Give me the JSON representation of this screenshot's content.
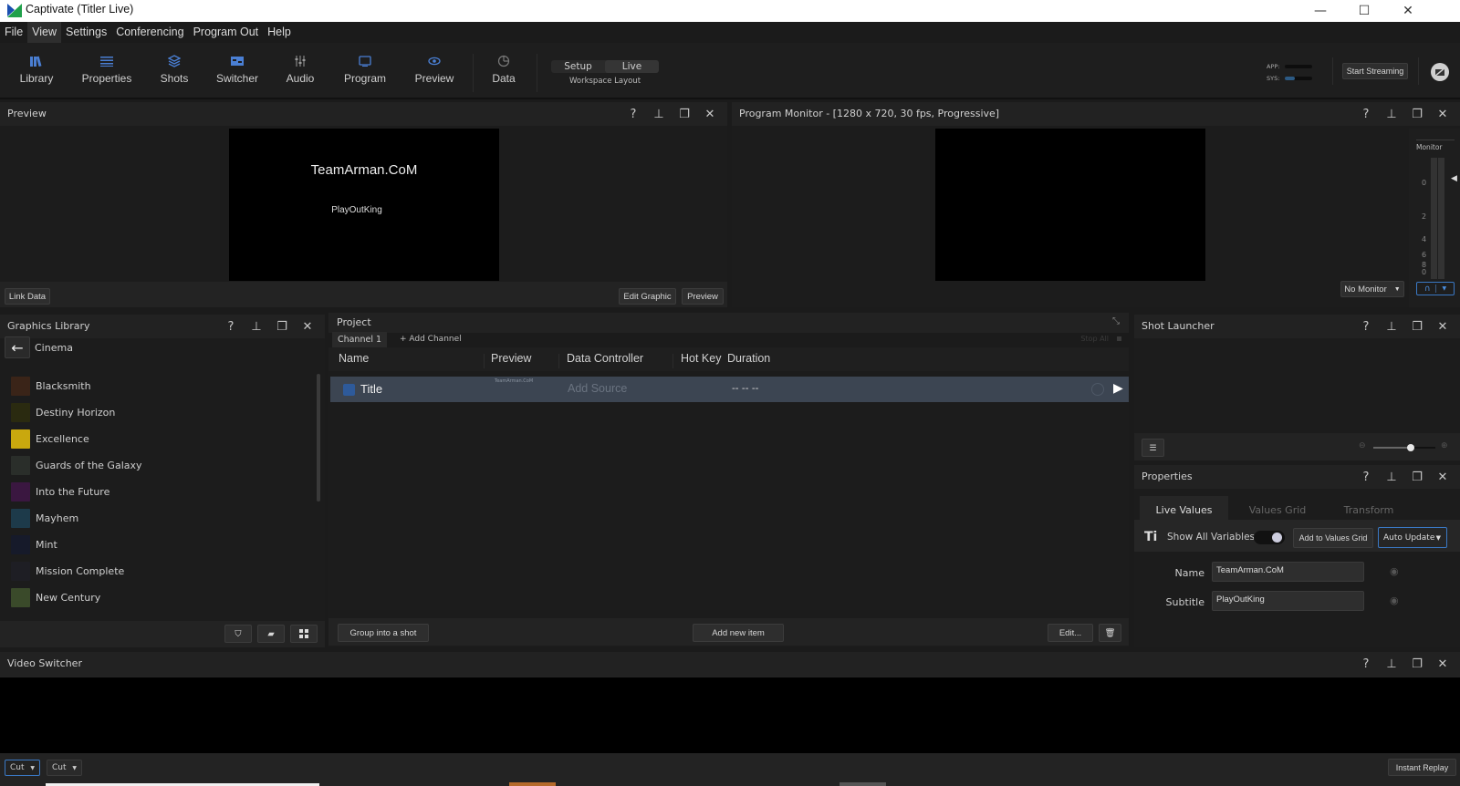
{
  "window": {
    "title": "Captivate (Titler Live)",
    "controls": {
      "minimize": "—",
      "maximize": "☐",
      "close": "✕"
    }
  },
  "menu": [
    "File",
    "View",
    "Settings",
    "Conferencing",
    "Program Out",
    "Help"
  ],
  "toolbar": {
    "tools": [
      {
        "label": "Library",
        "icon": "library-icon"
      },
      {
        "label": "Properties",
        "icon": "list-icon"
      },
      {
        "label": "Shots",
        "icon": "layers-icon"
      },
      {
        "label": "Switcher",
        "icon": "switcher-icon"
      },
      {
        "label": "Audio",
        "icon": "mixer-icon"
      },
      {
        "label": "Program",
        "icon": "monitor-icon"
      },
      {
        "label": "Preview",
        "icon": "eye-icon"
      },
      {
        "label": "Data",
        "icon": "pie-chart-icon"
      }
    ],
    "workspace": {
      "options": [
        "Setup",
        "Live"
      ],
      "selected": "Live",
      "label": "Workspace Layout"
    },
    "meters": {
      "app_label": "APP:",
      "sys_label": "SYS:",
      "app_level": 0.0,
      "sys_level": 0.35
    },
    "start_streaming": "Start Streaming"
  },
  "preview_panel": {
    "title": "Preview",
    "graphic_title": "TeamArman.CoM",
    "graphic_subtitle": "PlayOutKing",
    "link_data": "Link Data",
    "edit_graphic": "Edit Graphic",
    "preview_btn": "Preview"
  },
  "program_panel": {
    "title": "Program Monitor - [1280 x 720, 30 fps, Progressive]",
    "monitor_label": "Monitor",
    "scale": [
      "0",
      "2",
      "4",
      "6",
      "8",
      "0"
    ],
    "no_monitor": "No Monitor"
  },
  "graphics_library": {
    "title": "Graphics Library",
    "folder": "Cinema",
    "items": [
      {
        "name": "Blacksmith",
        "color": "#3a2418"
      },
      {
        "name": "Destiny Horizon",
        "color": "#2a2a10"
      },
      {
        "name": "Excellence",
        "color": "#c9a80e"
      },
      {
        "name": "Guards of the Galaxy",
        "color": "#2a2e2a"
      },
      {
        "name": "Into the Future",
        "color": "#3a1740"
      },
      {
        "name": "Mayhem",
        "color": "#1d3a4a"
      },
      {
        "name": "Mint",
        "color": "#161a2a"
      },
      {
        "name": "Mission Complete",
        "color": "#1e1e24"
      },
      {
        "name": "New Century",
        "color": "#3a4a2a"
      }
    ]
  },
  "project": {
    "title": "Project",
    "tabs": [
      "Channel 1"
    ],
    "add_channel": "+ Add Channel",
    "stop_all": "Stop All",
    "columns": [
      "Name",
      "Preview",
      "Data Controller",
      "Hot Key",
      "Duration"
    ],
    "rows": [
      {
        "name": "Title",
        "preview_text": "TeamArman.CoM",
        "data_controller": "Add Source",
        "hot_key": "",
        "duration": "-- -- --"
      }
    ],
    "group_into_shot": "Group into a shot",
    "add_new_item": "Add new item",
    "edit": "Edit..."
  },
  "shot_launcher": {
    "title": "Shot Launcher",
    "zoom_level": 0.6
  },
  "properties": {
    "title": "Properties",
    "tabs": [
      "Live Values",
      "Values Grid",
      "Transform"
    ],
    "active_tab": "Live Values",
    "show_all_variables": "Show All Variables",
    "show_all_on": true,
    "add_to_values_grid": "Add to Values Grid",
    "auto_update": "Auto Update",
    "fields": [
      {
        "label": "Name",
        "value": "TeamArman.CoM"
      },
      {
        "label": "Subtitle",
        "value": "PlayOutKing"
      }
    ]
  },
  "video_switcher": {
    "title": "Video Switcher",
    "transition1": "Cut",
    "transition2": "Cut",
    "instant_replay": "Instant Replay"
  },
  "colors": {
    "accent": "#4a7fd4",
    "panel": "#1c1c1c",
    "selected_row": "#3c4552"
  }
}
